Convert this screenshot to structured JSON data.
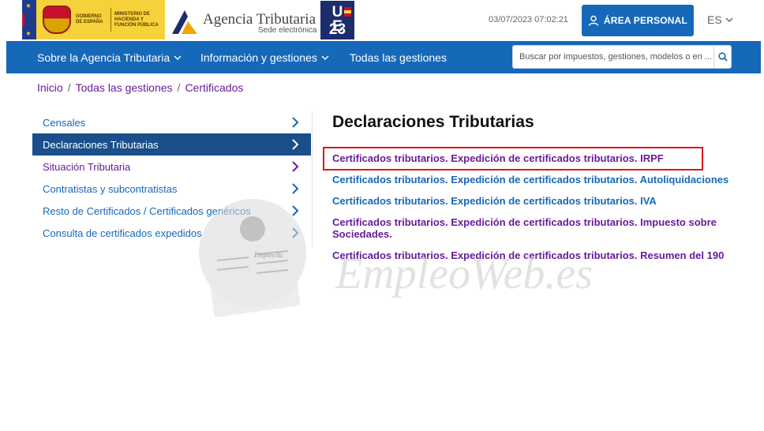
{
  "header": {
    "gov_text": "Gobierno de España",
    "ministry_text": "Ministerio de Hacienda y Función Pública",
    "agency_title": "Agencia Tributaria",
    "agency_subtitle": "Sede electrónica",
    "ue_badge": "U E 23",
    "datetime": "03/07/2023 07:02:21",
    "area_button": "ÁREA PERSONAL",
    "language": "ES"
  },
  "nav": {
    "items": [
      {
        "label": "Sobre la Agencia Tributaria",
        "has_dropdown": true
      },
      {
        "label": "Información y gestiones",
        "has_dropdown": true
      },
      {
        "label": "Todas las gestiones",
        "has_dropdown": false
      }
    ],
    "search_placeholder": "Buscar por impuestos, gestiones, modelos o en ..."
  },
  "breadcrumb": [
    "Inicio",
    "Todas las gestiones",
    "Certificados"
  ],
  "sidebar": {
    "items": [
      {
        "label": "Censales",
        "state": "normal"
      },
      {
        "label": "Declaraciones Tributarias",
        "state": "active"
      },
      {
        "label": "Situación Tributaria",
        "state": "visited"
      },
      {
        "label": "Contratistas y subcontratistas",
        "state": "normal"
      },
      {
        "label": "Resto de Certificados / Certificados genéricos",
        "state": "normal"
      },
      {
        "label": "Consulta de certificados expedidos",
        "state": "normal"
      }
    ]
  },
  "main": {
    "title": "Declaraciones Tributarias",
    "links": [
      {
        "label": "Certificados tributarios. Expedición de certificados tributarios. IRPF",
        "state": "visited",
        "highlighted": true
      },
      {
        "label": "Certificados tributarios. Expedición de certificados tributarios. Autoliquidaciones",
        "state": "normal"
      },
      {
        "label": "Certificados tributarios. Expedición de certificados tributarios. IVA",
        "state": "normal"
      },
      {
        "label": "Certificados tributarios. Expedición de certificados tributarios. Impuesto sobre Sociedades.",
        "state": "visited"
      },
      {
        "label": "Certificados tributarios. Expedición de certificados tributarios. Resumen del 190",
        "state": "visited"
      }
    ]
  },
  "watermark": {
    "text": "EmpleoWeb.es",
    "badge_text": "EmpleoYa"
  },
  "colors": {
    "primary_blue": "#1668b9",
    "active_blue": "#1a4f8a",
    "visited_purple": "#6a1b9a",
    "highlight_red": "#e0141e",
    "gov_yellow": "#f6d23a"
  },
  "icons": [
    "user-icon",
    "chevron-down-icon",
    "search-icon",
    "chevron-right-icon"
  ]
}
